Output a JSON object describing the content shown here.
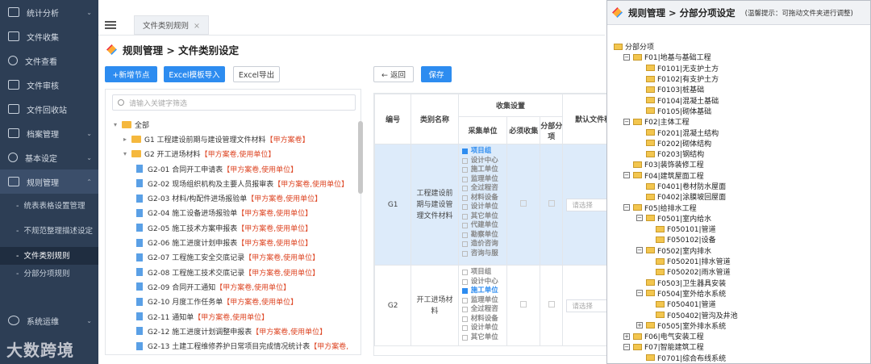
{
  "sidebar": {
    "items": [
      {
        "label": "统计分析",
        "icon": "chart-icon",
        "chevron": true
      },
      {
        "label": "文件收集",
        "icon": "collect-icon",
        "chevron": false
      },
      {
        "label": "文件查看",
        "icon": "search-icon",
        "chevron": false
      },
      {
        "label": "文件审核",
        "icon": "list-icon",
        "chevron": false
      },
      {
        "label": "文件回收站",
        "icon": "monitor-icon",
        "chevron": false
      },
      {
        "label": "档案管理",
        "icon": "grid-icon",
        "chevron": true
      },
      {
        "label": "基本设定",
        "icon": "gear-icon",
        "chevron": true
      },
      {
        "label": "规则管理",
        "icon": "rule-icon",
        "chevron": true
      }
    ],
    "sub_items": [
      "统表表格设置管理",
      "不规范整理描述设定",
      "文件类别规则",
      "分部分项规则"
    ],
    "selected_sub": "文件类别规则",
    "bottom_item": {
      "label": "系统运维",
      "icon": "gear-icon"
    },
    "watermark": "大数跨境"
  },
  "topbar": {
    "tab_label": "文件类别规则",
    "tab_close": "×"
  },
  "page": {
    "breadcrumb": "规则管理 > 文件类别设定"
  },
  "toolbar": {
    "add_node": "+新增节点",
    "import": "Excel模板导入",
    "export": "Excel导出",
    "back": "← 返回",
    "save": "保存"
  },
  "search": {
    "placeholder": "请输入关键字筛选"
  },
  "tree": {
    "root": "全部",
    "nodes": [
      {
        "level": 1,
        "type": "folder",
        "arrow": "▸",
        "label": "G1 工程建设前期与建设管理文件材料",
        "tag": "【甲方案卷】"
      },
      {
        "level": 1,
        "type": "folder",
        "arrow": "▾",
        "label": "G2 开工进场材料",
        "tag": "【甲方案卷,使用单位】"
      },
      {
        "level": 2,
        "type": "doc",
        "label": "G2-01 合同开工申请表",
        "tag": "【甲方案卷,使用单位】"
      },
      {
        "level": 2,
        "type": "doc",
        "label": "G2-02 现场组织机构及主要人员报审表",
        "tag": "【甲方案卷,使用单位】"
      },
      {
        "level": 2,
        "type": "doc",
        "label": "G2-03 材料/构配件进场报验单",
        "tag": "【甲方案卷,使用单位】"
      },
      {
        "level": 2,
        "type": "doc",
        "label": "G2-04 施工设备进场报验单",
        "tag": "【甲方案卷,使用单位】"
      },
      {
        "level": 2,
        "type": "doc",
        "label": "G2-05 施工技术方案申报表",
        "tag": "【甲方案卷,使用单位】"
      },
      {
        "level": 2,
        "type": "doc",
        "label": "G2-06 施工进度计划申报表",
        "tag": "【甲方案卷,使用单位】"
      },
      {
        "level": 2,
        "type": "doc",
        "label": "G2-07 工程施工安全交底记录",
        "tag": "【甲方案卷,使用单位】"
      },
      {
        "level": 2,
        "type": "doc",
        "label": "G2-08 工程施工技术交底记录",
        "tag": "【甲方案卷,使用单位】"
      },
      {
        "level": 2,
        "type": "doc",
        "label": "G2-09 合同开工通知",
        "tag": "【甲方案卷,使用单位】"
      },
      {
        "level": 2,
        "type": "doc",
        "label": "G2-10 月度工作任务单",
        "tag": "【甲方案卷,使用单位】"
      },
      {
        "level": 2,
        "type": "doc",
        "label": "G2-11 通知单",
        "tag": "【甲方案卷,使用单位】"
      },
      {
        "level": 2,
        "type": "doc",
        "label": "G2-12 施工进度计划调整申报表",
        "tag": "【甲方案卷,使用单位】"
      },
      {
        "level": 2,
        "type": "doc",
        "label": "G2-13 土建工程维修养护日常项目完成情况统计表",
        "tag": "【甲方案卷,"
      }
    ]
  },
  "table": {
    "headers": {
      "code": "编号",
      "name": "类别名称",
      "collect": "收集设置",
      "unit": "采集单位",
      "required": "必须收集",
      "sub": "分部分项",
      "default": "默认文件种"
    },
    "rows": [
      {
        "code": "G1",
        "name": "工程建设前期与建设管理文件材料",
        "units": [
          {
            "label": "项目组",
            "checked": true
          },
          {
            "label": "设计中心",
            "checked": false
          },
          {
            "label": "施工单位",
            "checked": false
          },
          {
            "label": "监理单位",
            "checked": false
          },
          {
            "label": "全过程咨",
            "checked": false
          },
          {
            "label": "材料设备",
            "checked": false
          },
          {
            "label": "设计单位",
            "checked": false
          },
          {
            "label": "其它单位",
            "checked": false
          },
          {
            "label": "代建单位",
            "checked": false
          },
          {
            "label": "勘察单位",
            "checked": false
          },
          {
            "label": "造价咨询",
            "checked": false
          },
          {
            "label": "咨询与服",
            "checked": false
          }
        ],
        "select_placeholder": "请选择"
      },
      {
        "code": "G2",
        "name": "开工进场材料",
        "units": [
          {
            "label": "项目组",
            "checked": false
          },
          {
            "label": "设计中心",
            "checked": false
          },
          {
            "label": "施工单位",
            "checked": true
          },
          {
            "label": "监理单位",
            "checked": false
          },
          {
            "label": "全过程咨",
            "checked": false
          },
          {
            "label": "材料设备",
            "checked": false
          },
          {
            "label": "设计单位",
            "checked": false
          },
          {
            "label": "其它单位",
            "checked": false
          }
        ],
        "select_placeholder": "请选择"
      }
    ]
  },
  "popup": {
    "title": "规则管理 > 分部分项设定",
    "hint": "(温馨提示：可拖动文件夹进行调整)",
    "root": "分部分项",
    "nodes": [
      {
        "level": 1,
        "box": "−",
        "label": "F01|地基与基础工程"
      },
      {
        "level": 2,
        "box": "",
        "label": "F0101|无支护土方"
      },
      {
        "level": 2,
        "box": "",
        "label": "F0102|有支护土方"
      },
      {
        "level": 2,
        "box": "",
        "label": "F0103|桩基础"
      },
      {
        "level": 2,
        "box": "",
        "label": "F0104|混凝土基础"
      },
      {
        "level": 2,
        "box": "",
        "label": "F0105|砌体基础"
      },
      {
        "level": 1,
        "box": "−",
        "label": "F02|主体工程"
      },
      {
        "level": 2,
        "box": "",
        "label": "F0201|混凝土结构"
      },
      {
        "level": 2,
        "box": "",
        "label": "F0202|砌体结构"
      },
      {
        "level": 2,
        "box": "",
        "label": "F0203|钢结构"
      },
      {
        "level": 1,
        "box": "",
        "label": "F03|装饰装修工程"
      },
      {
        "level": 1,
        "box": "−",
        "label": "F04|建筑屋面工程"
      },
      {
        "level": 2,
        "box": "",
        "label": "F0401|卷材防水屋面"
      },
      {
        "level": 2,
        "box": "",
        "label": "F0402|涂膜坡回屋面"
      },
      {
        "level": 1,
        "box": "−",
        "label": "F05|给排水工程"
      },
      {
        "level": 2,
        "box": "−",
        "label": "F0501|室内给水"
      },
      {
        "level": 3,
        "box": "",
        "label": "F050101|管道"
      },
      {
        "level": 3,
        "box": "",
        "label": "F050102|设备"
      },
      {
        "level": 2,
        "box": "−",
        "label": "F0502|室内排水"
      },
      {
        "level": 3,
        "box": "",
        "label": "F050201|排水管道"
      },
      {
        "level": 3,
        "box": "",
        "label": "F050202|雨水管道"
      },
      {
        "level": 2,
        "box": "",
        "label": "F0503|卫生器具安装"
      },
      {
        "level": 2,
        "box": "−",
        "label": "F0504|室外给水系统"
      },
      {
        "level": 3,
        "box": "",
        "label": "F050401|管道"
      },
      {
        "level": 3,
        "box": "",
        "label": "F050402|管沟及井池"
      },
      {
        "level": 2,
        "box": "+",
        "label": "F0505|室外排水系统"
      },
      {
        "level": 1,
        "box": "+",
        "label": "F06|电气安装工程"
      },
      {
        "level": 1,
        "box": "−",
        "label": "F07|智能建筑工程"
      },
      {
        "level": 2,
        "box": "",
        "label": "F0701|综合布线系统"
      }
    ]
  },
  "colors": {
    "primary": "#2d8cf0",
    "sidebar": "#2d3e55",
    "tag": "#dd4422",
    "folder": "#f5b83d"
  }
}
